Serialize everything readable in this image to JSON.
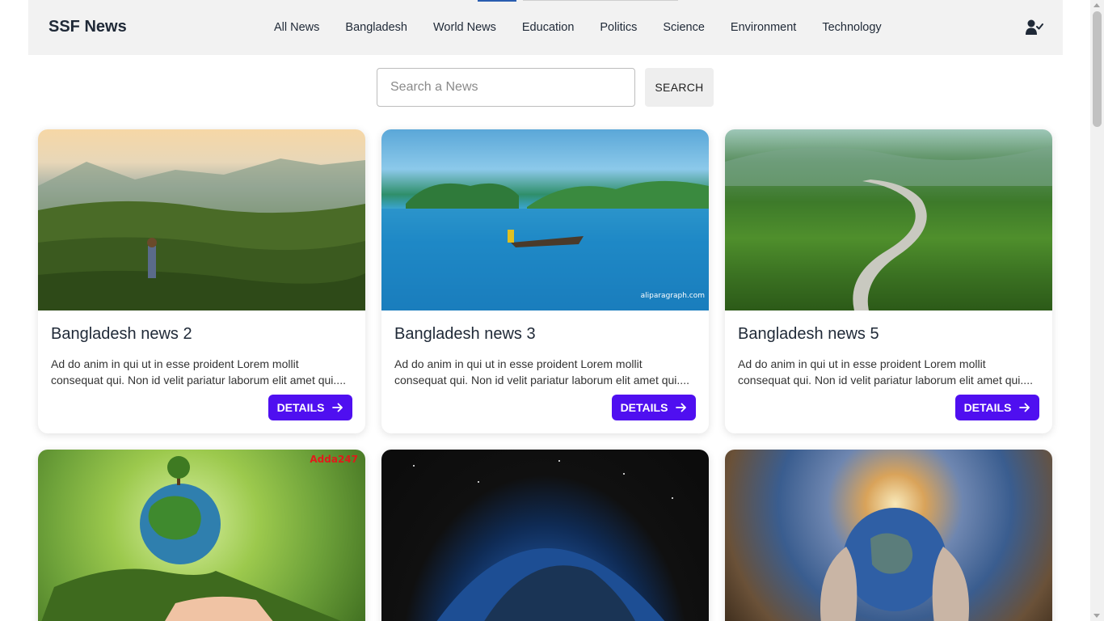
{
  "brand": "SSF News",
  "nav": {
    "links": [
      "All News",
      "Bangladesh",
      "World News",
      "Education",
      "Politics",
      "Science",
      "Environment",
      "Technology"
    ]
  },
  "search": {
    "placeholder": "Search a News",
    "button_label": "SEARCH"
  },
  "cards": [
    {
      "title": "Bangladesh news 2",
      "description": "Ad do anim in qui ut in esse proident Lorem mollit consequat qui. Non id velit pariatur laborum elit amet qui....",
      "button_label": "DETAILS"
    },
    {
      "title": "Bangladesh news 3",
      "description": "Ad do anim in qui ut in esse proident Lorem mollit consequat qui. Non id velit pariatur laborum elit amet qui....",
      "button_label": "DETAILS"
    },
    {
      "title": "Bangladesh news 5",
      "description": "Ad do anim in qui ut in esse proident Lorem mollit consequat qui. Non id velit pariatur laborum elit amet qui....",
      "button_label": "DETAILS"
    },
    {
      "title": "",
      "description": "",
      "button_label": ""
    },
    {
      "title": "",
      "description": "",
      "button_label": ""
    },
    {
      "title": "",
      "description": "",
      "button_label": ""
    }
  ],
  "image_watermarks": {
    "lake": "aliparagraph.com",
    "green_globe": "Adda247"
  },
  "colors": {
    "accent": "#4f0ff0",
    "navbar_bg": "#f2f2f2",
    "search_button_bg": "#eeeeee"
  },
  "icons": {
    "user": "user-check-icon",
    "details_arrow": "arrow-right-icon"
  }
}
